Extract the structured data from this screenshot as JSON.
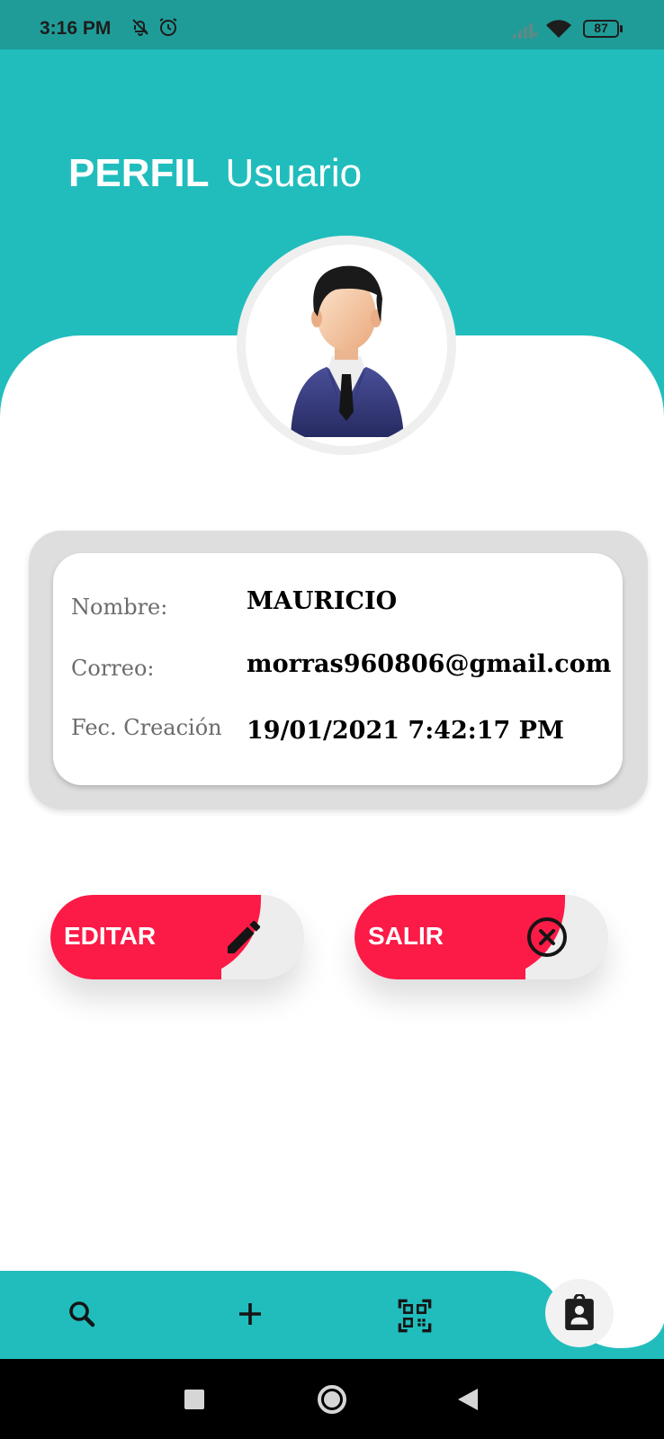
{
  "status_bar": {
    "time": "3:16 PM",
    "icons": [
      "bell-off-icon",
      "alarm-icon",
      "signal-icon",
      "wifi-icon"
    ],
    "battery": "87"
  },
  "header": {
    "title_bold": "PERFIL",
    "title_regular": "Usuario"
  },
  "profile": {
    "avatar": "avatar-businessman",
    "fields": [
      {
        "label": "Nombre:",
        "value": "MAURICIO"
      },
      {
        "label": "Correo:",
        "value": "morras960806@gmail.com"
      },
      {
        "label": "Fec. Creación",
        "value": "19/01/2021 7:42:17 PM"
      }
    ]
  },
  "actions": {
    "edit": {
      "label": "EDITAR",
      "icon": "pencil-icon"
    },
    "exit": {
      "label": "SALIR",
      "icon": "close-circle-icon"
    }
  },
  "bottom_nav": {
    "items": [
      "search-icon",
      "plus-icon",
      "qr-code-icon",
      "contact-badge-icon"
    ],
    "active": "contact-badge-icon"
  },
  "system_nav": [
    "recents-square-icon",
    "home-circle-icon",
    "back-triangle-icon"
  ],
  "colors": {
    "teal": "#21bdbd",
    "status_bar": "#1f9c98",
    "accent_red": "#fc1a47",
    "card_gray": "#dedede"
  }
}
